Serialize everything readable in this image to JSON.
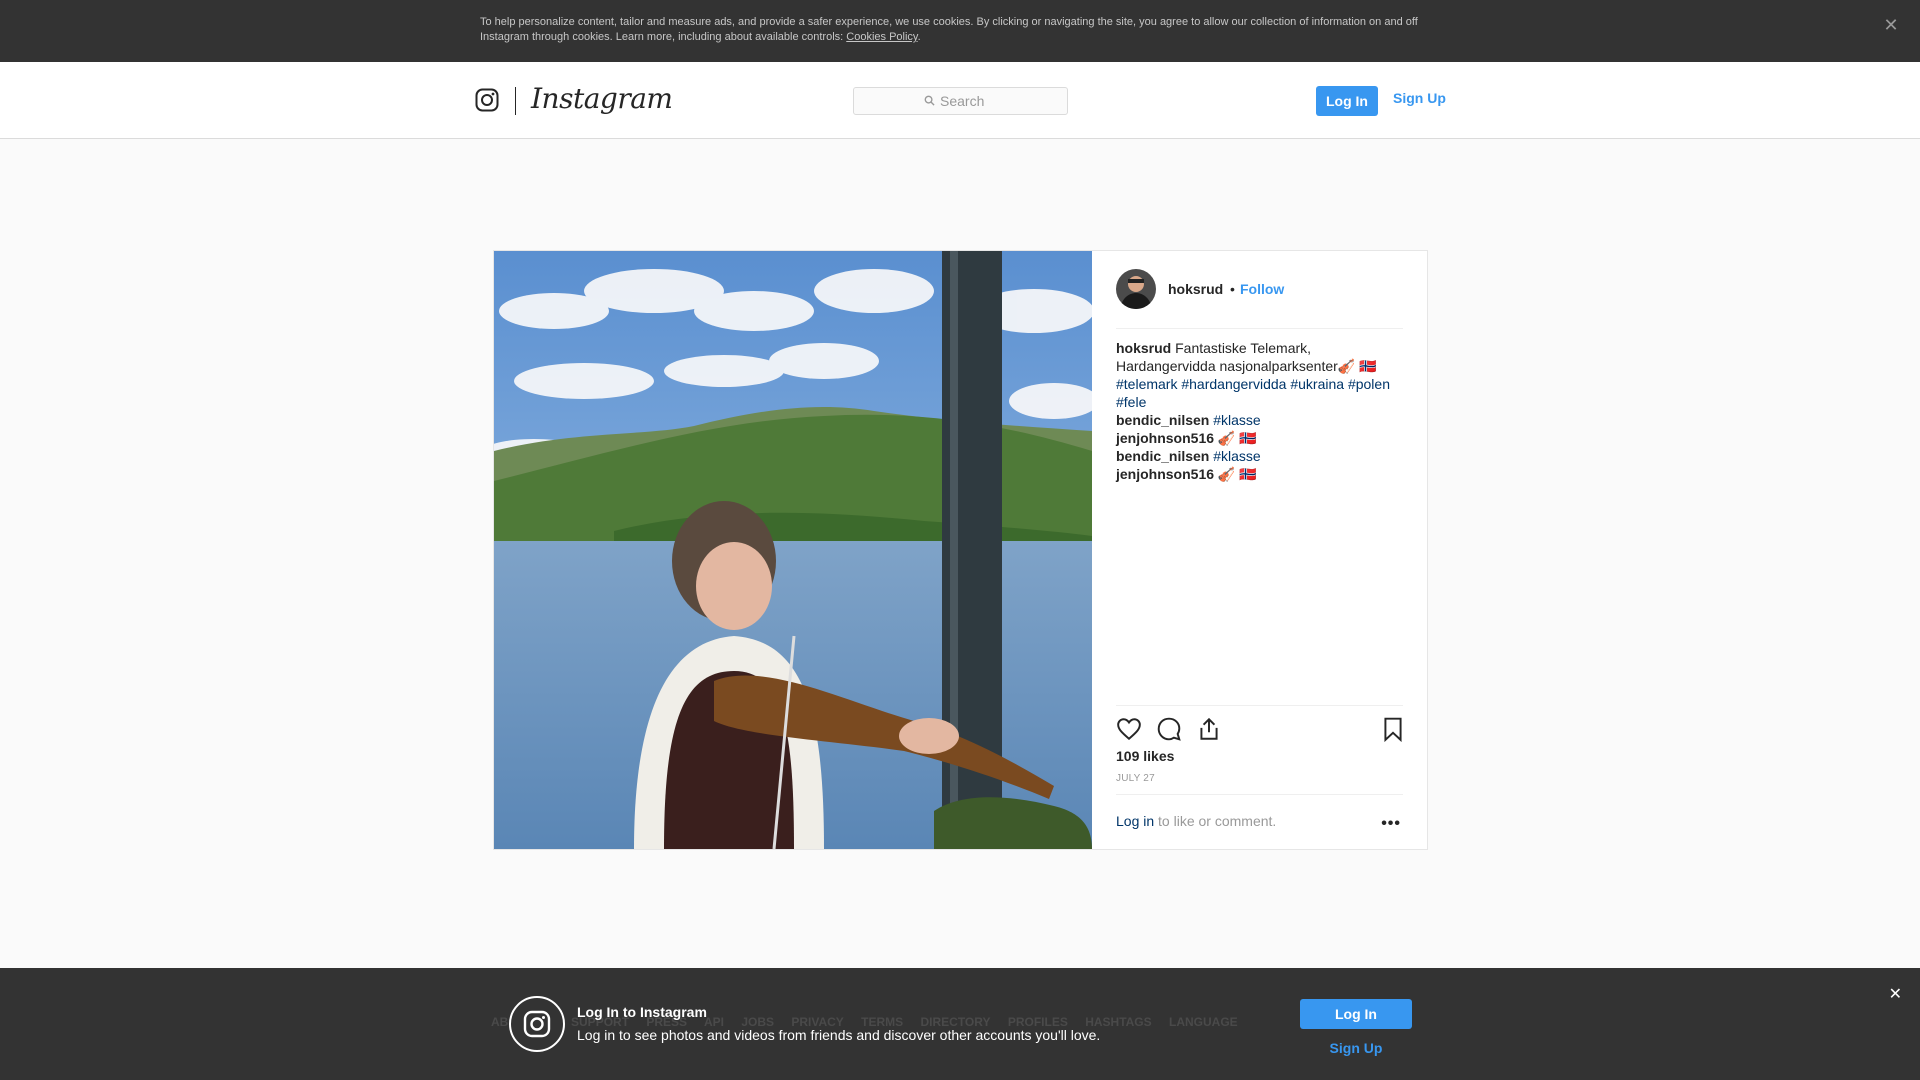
{
  "cookie_banner": {
    "text": "To help personalize content, tailor and measure ads, and provide a safer experience, we use cookies. By clicking or navigating the site, you agree to allow our collection of information on and off Instagram through cookies. Learn more, including about available controls: ",
    "link_label": "Cookies Policy",
    "suffix": ".",
    "close_glyph": "✕"
  },
  "header": {
    "logo_text": "Instagram",
    "search_placeholder": "Search",
    "login_label": "Log In",
    "signup_label": "Sign Up"
  },
  "post": {
    "username": "hoksrud",
    "dot": "•",
    "follow_label": "Follow",
    "caption": {
      "user": "hoksrud",
      "text": " Fantastiske Telemark, Hardangervidda nasjonalparksenter🎻 🇳🇴",
      "tags": [
        "#telemark",
        "#hardangervidda",
        "#ukraina",
        "#polen",
        "#fele"
      ]
    },
    "comments": [
      {
        "user": "bendic_nilsen",
        "text": "#klasse"
      },
      {
        "user": "jenjohnson516",
        "text": "🎻 🇳🇴"
      },
      {
        "user": "bendic_nilsen",
        "text": "#klasse"
      },
      {
        "user": "jenjohnson516",
        "text": "🎻 🇳🇴"
      }
    ],
    "likes": "109 likes",
    "date": "JULY 27",
    "login_link": "Log in",
    "login_suffix": " to like or comment.",
    "more_glyph": "•••"
  },
  "footer": {
    "links_visible": [
      "ABOUT US",
      "SUPPORT",
      "PRESS",
      "API",
      "JOBS",
      "PRIVACY",
      "TERMS",
      "DIRECTORY",
      "PROFILES",
      "HASHTAGS",
      "LANGUAGE"
    ]
  },
  "bottom_bar": {
    "title": "Log In to Instagram",
    "subtitle": "Log in to see photos and videos from friends and discover other accounts you'll love.",
    "login_label": "Log In",
    "signup_label": "Sign Up",
    "close_glyph": "✕"
  },
  "colors": {
    "accent": "#3897f0",
    "tag_link": "#003569",
    "bar_bg": "#333333"
  },
  "icons": [
    "instagram-glyph-icon",
    "search-icon",
    "heart-icon",
    "comment-icon",
    "share-icon",
    "bookmark-icon",
    "close-icon"
  ]
}
